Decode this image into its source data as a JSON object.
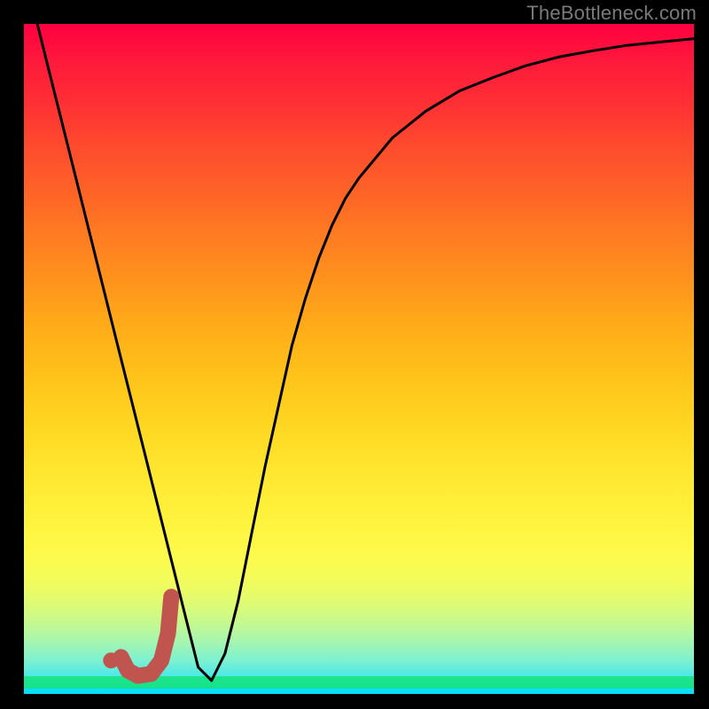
{
  "watermark": "TheBottleneck.com",
  "chart_data": {
    "type": "line",
    "title": "",
    "xlabel": "",
    "ylabel": "",
    "xlim": [
      0,
      100
    ],
    "ylim": [
      0,
      100
    ],
    "grid": false,
    "legend": false,
    "series": [
      {
        "name": "bottleneck-curve",
        "x": [
          2,
          4,
          6,
          8,
          10,
          12,
          14,
          16,
          18,
          20,
          22,
          24,
          26,
          28,
          30,
          32,
          34,
          36,
          38,
          40,
          42,
          44,
          46,
          48,
          50,
          55,
          60,
          65,
          70,
          75,
          80,
          85,
          90,
          95,
          100
        ],
        "y": [
          100,
          92,
          84,
          76,
          68,
          60,
          52,
          44,
          36,
          28,
          20,
          12,
          4,
          2,
          6,
          14,
          24,
          34,
          43,
          52,
          59,
          65,
          70,
          74,
          77,
          83,
          87,
          90,
          92,
          93.8,
          95.1,
          96.0,
          96.8,
          97.3,
          97.8
        ]
      }
    ],
    "marker": {
      "name": "j-marker",
      "color": "#c0554f",
      "dot": {
        "x": 13,
        "y": 5
      },
      "path_x": [
        14.5,
        15.5,
        17,
        19,
        20.5,
        21.5,
        22
      ],
      "path_y": [
        5.5,
        3.5,
        2.7,
        3.0,
        5.0,
        9.0,
        14.5
      ]
    },
    "background_gradient": {
      "top": "#ff0040",
      "mid": "#ffe730",
      "bottom": "#00ddff"
    }
  }
}
